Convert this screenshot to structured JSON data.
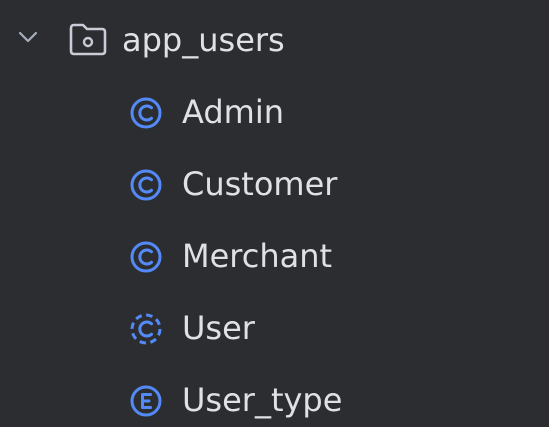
{
  "tree": {
    "folder": {
      "label": "app_users",
      "icon": "folder-package-icon",
      "expanded": true
    },
    "items": [
      {
        "label": "Admin",
        "kind": "class",
        "icon": "class-icon"
      },
      {
        "label": "Customer",
        "kind": "class",
        "icon": "class-icon"
      },
      {
        "label": "Merchant",
        "kind": "class",
        "icon": "class-icon"
      },
      {
        "label": "User",
        "kind": "abstract-class",
        "icon": "abstract-class-icon"
      },
      {
        "label": "User_type",
        "kind": "enum",
        "icon": "enum-icon"
      }
    ]
  },
  "colors": {
    "background": "#2b2d30",
    "text": "#dfe1e5",
    "icon_accent": "#548af7",
    "chevron": "#a8adbd",
    "folder_outline": "#c9ccd6"
  }
}
